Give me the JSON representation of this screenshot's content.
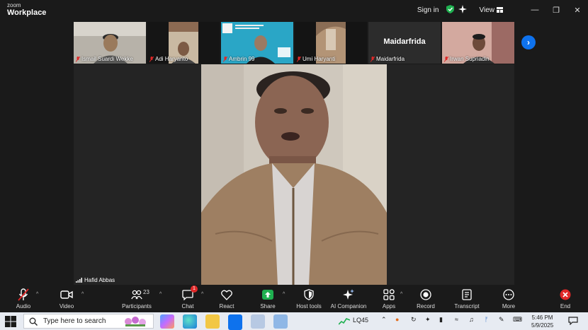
{
  "app": {
    "logo_top": "zoom",
    "logo_bottom": "Workplace"
  },
  "titlebar": {
    "signin": "Sign in",
    "view": "View",
    "icons": [
      "shield-check-icon",
      "sparkle-icon",
      "minimize-icon",
      "restore-icon",
      "close-icon"
    ]
  },
  "gallery": {
    "tiles": [
      {
        "name": "Ismail Suardi Wekke",
        "muted": true
      },
      {
        "name": "Adi Haryanto",
        "muted": true
      },
      {
        "name": "Ambrin 99",
        "muted": true
      },
      {
        "name": "Umi Haryanti",
        "muted": true
      },
      {
        "name": "Maidarfrida",
        "muted": true,
        "display_name": "Maidarfrida"
      },
      {
        "name": "Irwan Supriadin",
        "muted": true
      }
    ],
    "next_icon": "chevron-right-icon"
  },
  "stage": {
    "speaker": "Hafid Abbas"
  },
  "toolbar": {
    "audio": "Audio",
    "video": "Video",
    "participants": "Participants",
    "participants_count": "23",
    "chat": "Chat",
    "chat_badge": "1",
    "react": "React",
    "share": "Share",
    "host_tools": "Host tools",
    "ai_companion": "AI Companion",
    "apps": "Apps",
    "record": "Record",
    "transcript": "Transcript",
    "more": "More",
    "end": "End"
  },
  "taskbar": {
    "search_placeholder": "Type here to search",
    "stock_ticker": "LQ45",
    "time": "5:46 PM",
    "date": "5/9/2025",
    "colors": {
      "accent": "#0e72ed",
      "end": "#e02828",
      "share": "#1fb050"
    }
  }
}
